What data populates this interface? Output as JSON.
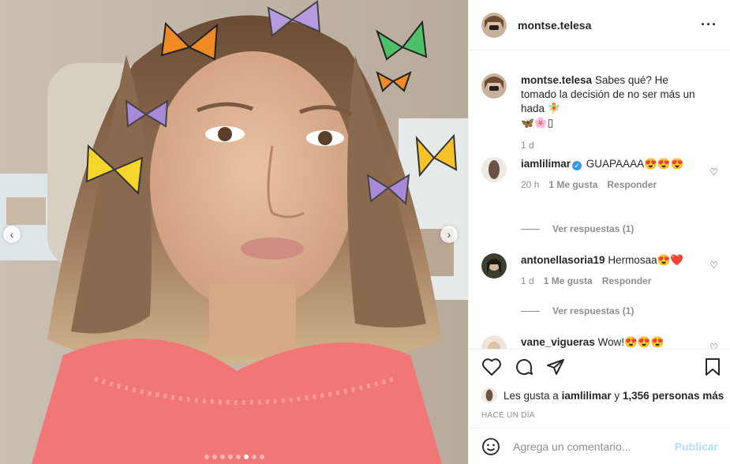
{
  "post": {
    "username": "montse.telesa",
    "more_icon": "more-horizontal-icon",
    "media": {
      "carousel_total": 8,
      "carousel_active": 6,
      "prev_icon": "chevron-left-icon",
      "next_icon": "chevron-right-icon"
    }
  },
  "caption": {
    "username": "montse.telesa",
    "text": "Sabes qué? He tomado la decisión de no ser más un hada 🧚",
    "emojis": "🦋🌸▯",
    "time": "1 d"
  },
  "comments": [
    {
      "username": "iamlilimar",
      "verified": true,
      "text": "GUAPAAAA😍😍😍",
      "time": "20 h",
      "likes": "1 Me gusta",
      "reply": "Responder",
      "view_replies": "Ver respuestas (1)"
    },
    {
      "username": "antonellasoria19",
      "text": "Hermosaa😍❤️",
      "time": "1 d",
      "likes": "1 Me gusta",
      "reply": "Responder",
      "view_replies": "Ver respuestas (1)"
    },
    {
      "username": "vane_vigueras",
      "text": "Wow!😍😍😍"
    }
  ],
  "likes": {
    "prefix": "Les gusta a",
    "first_user": "iamlilimar",
    "joiner": "y",
    "others": "1,356 personas más"
  },
  "timestamp": "HACE UN DÍA",
  "add_comment": {
    "placeholder": "Agrega un comentario...",
    "publish_label": "Publicar",
    "emoji_icon": "smiley-icon"
  },
  "colors": {
    "publish_disabled": "#b2dffc",
    "verified": "#3897f0",
    "heart_red": "#ed4956"
  }
}
